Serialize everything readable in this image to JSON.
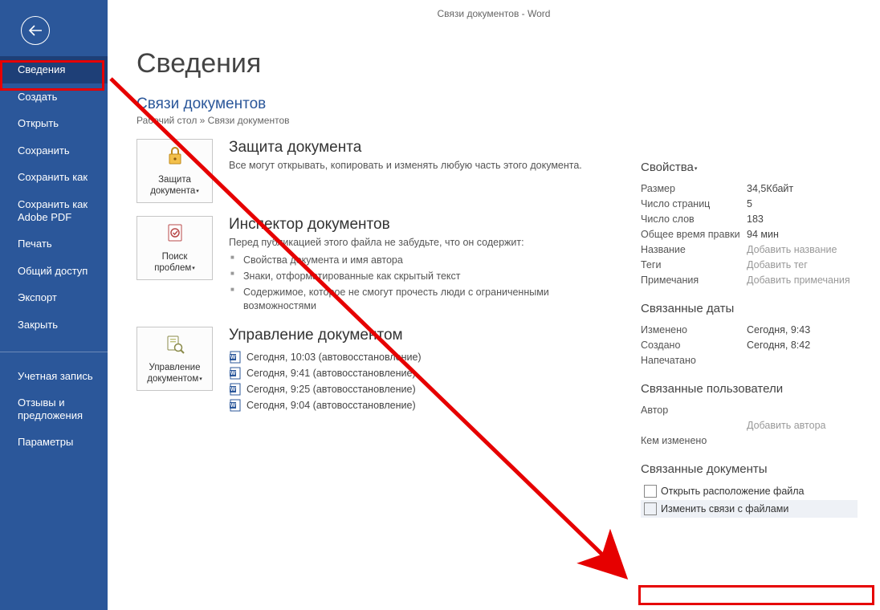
{
  "title_bar": "Связи документов  -  Word",
  "nav": {
    "items": [
      "Сведения",
      "Создать",
      "Открыть",
      "Сохранить",
      "Сохранить как",
      "Сохранить как Adobe PDF",
      "Печать",
      "Общий доступ",
      "Экспорт",
      "Закрыть",
      "Учетная запись",
      "Отзывы и предложения",
      "Параметры"
    ],
    "active_index": 0
  },
  "page_title": "Сведения",
  "doc_name": "Связи документов",
  "breadcrumb": "Рабочий стол » Связи документов",
  "sections": {
    "protect": {
      "btn": "Защита документа",
      "tri": "▾",
      "title": "Защита документа",
      "text": "Все могут открывать, копировать и изменять любую часть этого документа."
    },
    "inspect": {
      "btn": "Поиск проблем",
      "tri": "▾",
      "title": "Инспектор документов",
      "intro": "Перед публикацией этого файла не забудьте, что он содержит:",
      "items": [
        "Свойства документа и имя автора",
        "Знаки, отформатированные как скрытый текст",
        "Содержимое, которое не смогут прочесть люди с ограниченными возможностями"
      ]
    },
    "manage": {
      "btn": "Управление документом",
      "tri": "▾",
      "title": "Управление документом",
      "versions": [
        "Сегодня, 10:03 (автовосстановление)",
        "Сегодня, 9:41 (автовосстановление)",
        "Сегодня, 9:25 (автовосстановление)",
        "Сегодня, 9:04 (автовосстановление)"
      ]
    }
  },
  "props": {
    "header": "Свойства",
    "tri": "▾",
    "rows": [
      {
        "k": "Размер",
        "v": "34,5Кбайт"
      },
      {
        "k": "Число страниц",
        "v": "5"
      },
      {
        "k": "Число слов",
        "v": "183"
      },
      {
        "k": "Общее время правки",
        "v": "94 мин"
      },
      {
        "k": "Название",
        "v": "Добавить название",
        "ph": true
      },
      {
        "k": "Теги",
        "v": "Добавить тег",
        "ph": true
      },
      {
        "k": "Примечания",
        "v": "Добавить примечания",
        "ph": true
      }
    ],
    "dates_header": "Связанные даты",
    "dates": [
      {
        "k": "Изменено",
        "v": "Сегодня, 9:43"
      },
      {
        "k": "Создано",
        "v": "Сегодня, 8:42"
      },
      {
        "k": "Напечатано",
        "v": ""
      }
    ],
    "people_header": "Связанные пользователи",
    "people": [
      {
        "k": "Автор",
        "v": ""
      },
      {
        "k": "",
        "v": "Добавить автора",
        "ph": true
      },
      {
        "k": "Кем изменено",
        "v": ""
      }
    ],
    "reldocs_header": "Связанные документы",
    "reldocs": [
      {
        "label": "Открыть расположение файла"
      },
      {
        "label": "Изменить связи с файлами",
        "hl": true
      }
    ]
  }
}
